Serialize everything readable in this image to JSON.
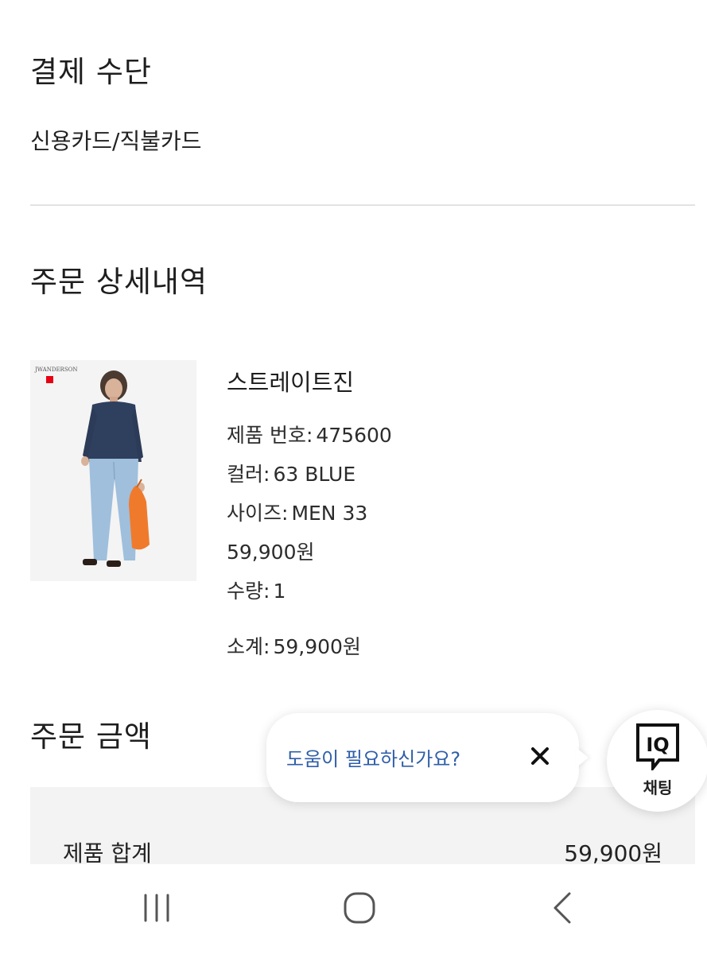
{
  "payment": {
    "section_title": "결제 수단",
    "method": "신용카드/직불카드"
  },
  "order_details": {
    "section_title": "주문 상세내역",
    "item": {
      "image_brand_text": "JWANDERSON",
      "name": "스트레이트진",
      "product_number_label": "제품 번호:",
      "product_number": "475600",
      "color_label": "컬러:",
      "color": "63 BLUE",
      "size_label": "사이즈:",
      "size": "MEN 33",
      "price": "59,900원",
      "quantity_label": "수량:",
      "quantity": "1",
      "subtotal_label": "소계:",
      "subtotal": "59,900원"
    }
  },
  "order_amount": {
    "section_title": "주문 금액",
    "rows": [
      {
        "label": "제품 합계",
        "value": "59,900원"
      }
    ]
  },
  "help_popup": {
    "text": "도움이 필요하신가요?",
    "close_icon": "close-icon"
  },
  "chat": {
    "icon_text": "IQ",
    "label": "채팅"
  },
  "system_nav": {
    "recents_icon": "recent-apps-icon",
    "home_icon": "home-icon",
    "back_icon": "back-icon"
  },
  "colors": {
    "help_text": "#2f5ea8",
    "divider": "#e3e3e3",
    "summary_bg": "#f3f3f3",
    "jeans": "#9fbfdc",
    "bag": "#f07a2c"
  }
}
